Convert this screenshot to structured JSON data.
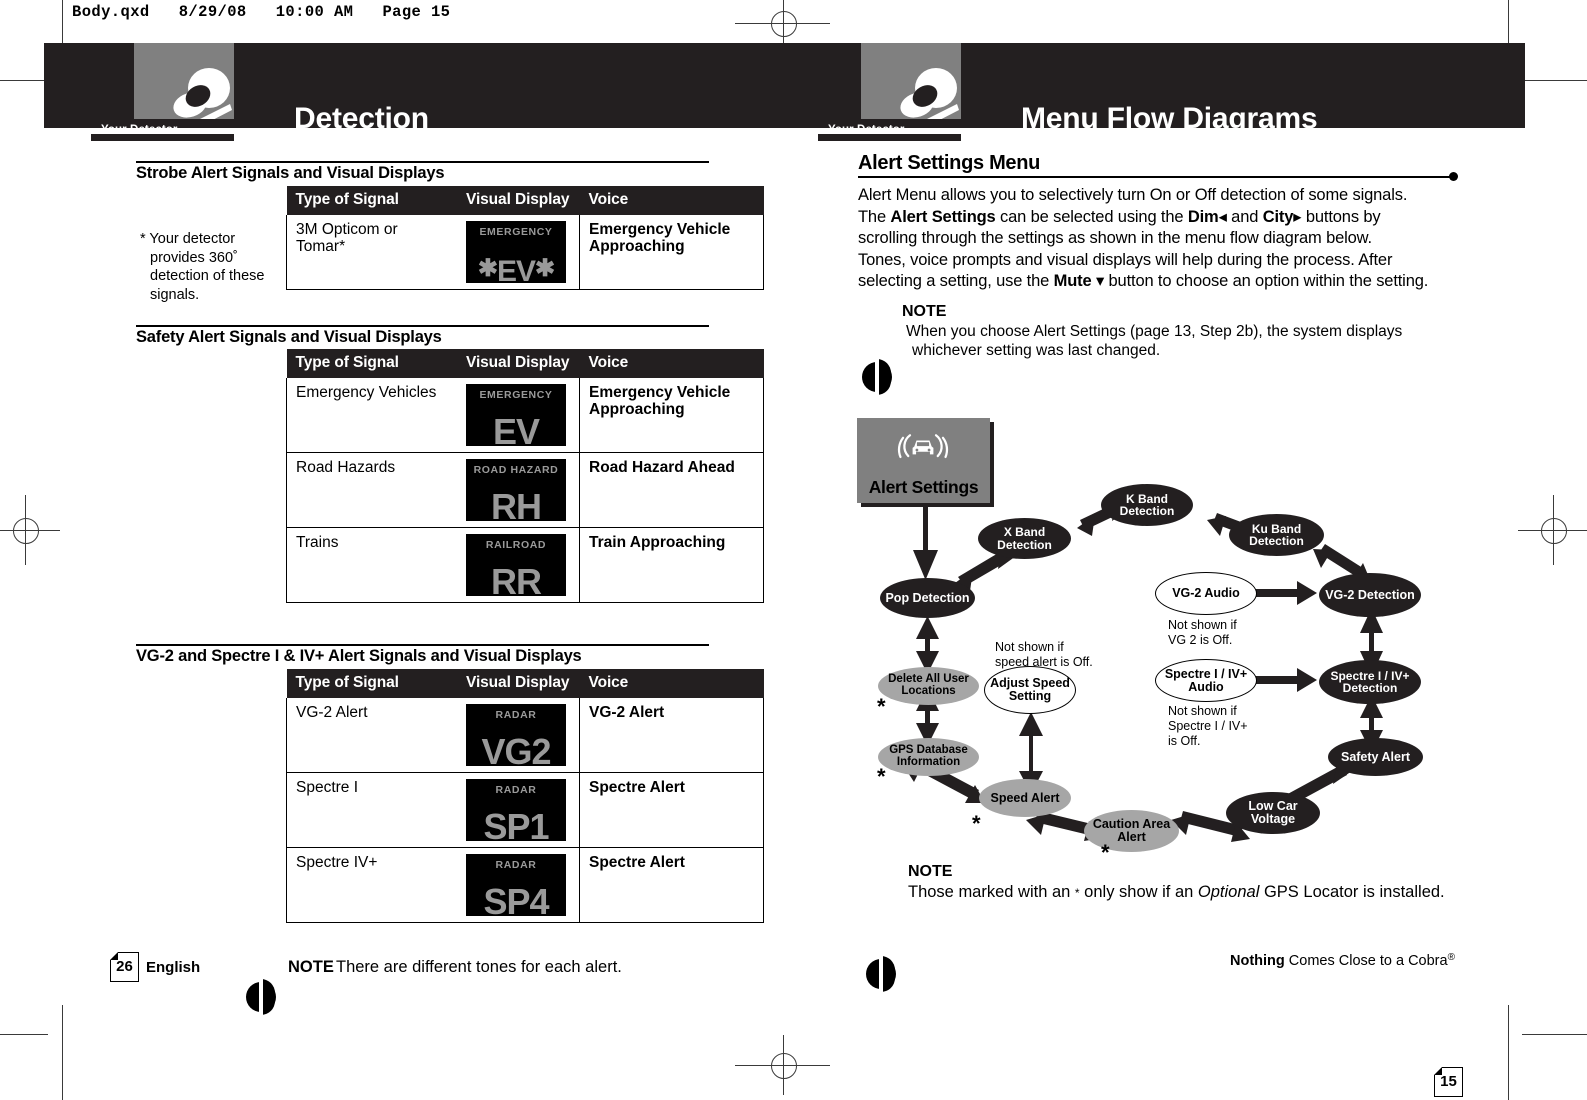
{
  "slug": "Body.qxd   8/29/08   10:00 AM   Page 15",
  "left_page": {
    "header": {
      "title": "Detection",
      "tag": "Your Detector",
      "icon": "detector-icon"
    },
    "sections": [
      {
        "heading": "Strobe Alert Signals and Visual Displays",
        "columns": [
          "Type of Signal",
          "Visual Display",
          "Voice"
        ],
        "rows": [
          {
            "type": "3M Opticom or Tomar*",
            "display_top": "EMERGENCY",
            "display_big": "EV",
            "display_stars": true,
            "voice": "Emergency Vehicle Approaching"
          }
        ],
        "sidenote": "* Your detector provides 360˚ detection of these signals."
      },
      {
        "heading": "Safety Alert Signals and Visual Displays",
        "columns": [
          "Type of Signal",
          "Visual Display",
          "Voice"
        ],
        "rows": [
          {
            "type": "Emergency Vehicles",
            "display_top": "EMERGENCY",
            "display_big": "EV",
            "voice": "Emergency Vehicle Approaching"
          },
          {
            "type": "Road Hazards",
            "display_top": "ROAD HAZARD",
            "display_big": "RH",
            "voice": "Road Hazard Ahead"
          },
          {
            "type": "Trains",
            "display_top": "RAILROAD",
            "display_big": "RR",
            "voice": "Train Approaching"
          }
        ]
      },
      {
        "heading": "VG-2 and Spectre I & IV+ Alert Signals and Visual Displays",
        "columns": [
          "Type of Signal",
          "Visual Display",
          "Voice"
        ],
        "rows": [
          {
            "type": "VG-2 Alert",
            "display_top": "RADAR",
            "display_big": "VG2",
            "voice": "VG-2 Alert"
          },
          {
            "type": "Spectre I",
            "display_top": "RADAR",
            "display_big": "SP1",
            "voice": "Spectre Alert"
          },
          {
            "type": "Spectre IV+",
            "display_top": "RADAR",
            "display_big": "SP4",
            "voice": "Spectre Alert"
          }
        ]
      }
    ],
    "footer": {
      "page_number": "26",
      "language": "English",
      "note_label": "NOTE",
      "note_text": "There are different tones for each alert."
    }
  },
  "right_page": {
    "header": {
      "title": "Menu Flow Diagrams",
      "tag": "Your Detector",
      "icon": "detector-icon"
    },
    "title": "Alert Settings Menu",
    "intro": {
      "l1_a": "Alert Menu allows you to selectively turn On or Off detection of some signals.",
      "l2_a": "The ",
      "l2_b": "Alert Settings",
      "l2_c": " can be selected using the ",
      "l2_d": "Dim",
      "l2_e": " and ",
      "l2_f": "City",
      "l2_g": " buttons by",
      "l3_a": "scrolling through the settings as shown in the menu flow diagram below.",
      "l4_a": "Tones, voice prompts and visual displays will help during the process. After",
      "l5_a": "selecting a setting, use the ",
      "l5_b": "Mute",
      "l5_c": " button to choose an option within the setting."
    },
    "note_top": {
      "label": "NOTE",
      "line1": "When you choose Alert Settings (page 13, Step 2b), the system displays",
      "line2": "whichever setting was last changed."
    },
    "note_bottom": {
      "label": "NOTE",
      "text_a": "Those marked with an ",
      "text_star": "*",
      "text_b": " only show if an ",
      "text_italic": "Optional",
      "text_c": " GPS Locator is installed."
    },
    "footer": {
      "tagline_bold": "Nothing",
      "tagline_rest": " Comes Close to a Cobra",
      "tagline_reg": "®",
      "page_number": "15"
    }
  },
  "diagram": {
    "start": {
      "label": "Alert Settings",
      "icon": "car-signal-icon",
      "style": "gray-box"
    },
    "nodes": [
      {
        "id": "pop",
        "label": "Pop Detection",
        "style": "black",
        "gps_only": false
      },
      {
        "id": "xband",
        "label": "X Band Detection",
        "style": "black",
        "gps_only": false
      },
      {
        "id": "kband",
        "label": "K Band Detection",
        "style": "black",
        "gps_only": false
      },
      {
        "id": "kuband",
        "label": "Ku Band Detection",
        "style": "black",
        "gps_only": false
      },
      {
        "id": "vg2det",
        "label": "VG-2 Detection",
        "style": "black",
        "gps_only": false
      },
      {
        "id": "vg2aud",
        "label": "VG-2 Audio",
        "style": "open",
        "gps_only": false
      },
      {
        "id": "spdet",
        "label": "Spectre I / IV+ Detection",
        "style": "black",
        "gps_only": false
      },
      {
        "id": "spaud",
        "label": "Spectre I / IV+ Audio",
        "style": "open",
        "gps_only": false
      },
      {
        "id": "safety",
        "label": "Safety Alert",
        "style": "black",
        "gps_only": false
      },
      {
        "id": "lowcar",
        "label": "Low Car Voltage",
        "style": "black",
        "gps_only": false
      },
      {
        "id": "caution",
        "label": "Caution Area Alert",
        "style": "gray",
        "gps_only": true
      },
      {
        "id": "speed",
        "label": "Speed Alert",
        "style": "gray",
        "gps_only": true
      },
      {
        "id": "adjspeed",
        "label": "Adjust Speed Setting",
        "style": "open",
        "gps_only": false
      },
      {
        "id": "gpsdb",
        "label": "GPS Database Information",
        "style": "gray",
        "gps_only": true
      },
      {
        "id": "delete",
        "label": "Delete All User Locations",
        "style": "gray",
        "gps_only": true
      }
    ],
    "conditions": [
      {
        "for": "vg2aud",
        "line1": "Not shown if",
        "line2": "VG 2 is Off.",
        "line3": ""
      },
      {
        "for": "spaud",
        "line1": "Not shown if",
        "line2": "Spectre I / IV+",
        "line3": "is Off."
      },
      {
        "for": "adjspeed",
        "line1": "Not shown if",
        "line2": "speed alert is Off.",
        "line3": ""
      }
    ],
    "gps_marker": "*"
  }
}
